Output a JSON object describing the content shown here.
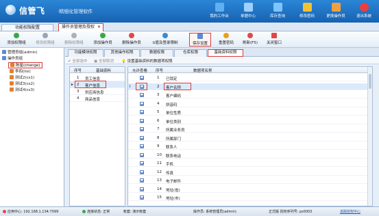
{
  "app": {
    "logo_text": "信管飞",
    "logo_slogan": "·精细化管理软件"
  },
  "header_buttons": [
    {
      "label": "我的工作台",
      "icon": "monitor-icon",
      "color": "#5fb0f0"
    },
    {
      "label": "单据中心",
      "icon": "document-icon",
      "color": "#9fd0ff"
    },
    {
      "label": "库存查询",
      "icon": "box-icon",
      "color": "#7fc4ff"
    },
    {
      "label": "修改密码",
      "icon": "lock-icon",
      "color": "#f2c230"
    },
    {
      "label": "更换操作员",
      "icon": "user-icon",
      "color": "#f0a040"
    },
    {
      "label": "退出系统",
      "icon": "exit-icon",
      "color": "#e84040"
    }
  ],
  "tabs": {
    "left": "功能权限配置",
    "right": "操作员管理及授权",
    "close": "✕"
  },
  "toolbar": [
    {
      "label": "添加权限组",
      "icon": "add-group-icon",
      "color": "#3aa64a",
      "enabled": true
    },
    {
      "label": "修改权限组",
      "icon": "edit-group-icon",
      "color": "#9aa6b2",
      "enabled": false
    },
    {
      "label": "删除权限组",
      "icon": "delete-group-icon",
      "color": "#b0b0b0",
      "enabled": false
    },
    {
      "label": "添加操作员",
      "icon": "add-user-icon",
      "color": "#3aa64a",
      "enabled": true
    },
    {
      "label": "删除操作员",
      "icon": "delete-user-icon",
      "color": "#e04848",
      "enabled": true
    },
    {
      "label": "U盾及登录限制",
      "icon": "usb-key-icon",
      "color": "#3a8ad6",
      "enabled": true
    },
    {
      "label": "保存设置",
      "icon": "save-icon",
      "color": "#5b8ad6",
      "enabled": true
    },
    {
      "label": "重置密码",
      "icon": "key-icon",
      "color": "#e8a020",
      "enabled": true
    },
    {
      "label": "刷新(F5)",
      "icon": "refresh-icon",
      "color": "#e04848",
      "enabled": true
    },
    {
      "label": "关闭窗口",
      "icon": "close-window-icon",
      "color": "#e04848",
      "enabled": true
    }
  ],
  "tree": [
    {
      "label": "管理员组(admin)",
      "level": 0,
      "icon": "folder-icon",
      "color": "#5b8ad6"
    },
    {
      "label": "操作员组",
      "level": 0,
      "icon": "folder-icon",
      "color": "#5b8ad6"
    },
    {
      "label": "陈星(chenge)",
      "level": 1,
      "icon": "user-icon",
      "color": "#e08030",
      "selected": true
    },
    {
      "label": "李四(lisi)",
      "level": 1,
      "icon": "user-icon",
      "color": "#e08030"
    },
    {
      "label": "测试2(cs1)",
      "level": 1,
      "icon": "user-icon",
      "color": "#e08030"
    },
    {
      "label": "测试3(cs2)",
      "level": 1,
      "icon": "user-icon",
      "color": "#e08030"
    },
    {
      "label": "测试4(cs3)",
      "level": 1,
      "icon": "user-icon",
      "color": "#e08030"
    }
  ],
  "func_tabs": [
    {
      "label": "功能模块权限"
    },
    {
      "label": "其他操作权限"
    },
    {
      "label": "数据权限"
    },
    {
      "label": "仓库权限"
    },
    {
      "label": "基础资料权限",
      "active": true
    }
  ],
  "subbar": {
    "select_all": "全部选中",
    "deselect_all": "全部取消",
    "hint": "设置基础资料的数据项权限"
  },
  "left_grid": {
    "headers": [
      "序号",
      "基础资料"
    ],
    "rows": [
      {
        "no": "1",
        "name": "员工信息"
      },
      {
        "no": "2",
        "name": "客户信息",
        "selected": true
      },
      {
        "no": "3",
        "name": "供应商信息"
      },
      {
        "no": "4",
        "name": "商品信息"
      }
    ]
  },
  "right_grid": {
    "headers": [
      "允许查看",
      "序号",
      "数据项名称"
    ],
    "row_marker": "I",
    "rows": [
      {
        "checked": true,
        "no": "1",
        "name": "已锁定"
      },
      {
        "checked": true,
        "no": "2",
        "name": "客户名称",
        "selected": true
      },
      {
        "checked": true,
        "no": "3",
        "name": "客户编码"
      },
      {
        "checked": true,
        "no": "4",
        "name": "拼音码"
      },
      {
        "checked": true,
        "no": "5",
        "name": "单位性质"
      },
      {
        "checked": true,
        "no": "6",
        "name": "单位类别"
      },
      {
        "checked": true,
        "no": "7",
        "name": "所属业务员"
      },
      {
        "checked": true,
        "no": "8",
        "name": "所属部门"
      },
      {
        "checked": true,
        "no": "9",
        "name": "联系人"
      },
      {
        "checked": true,
        "no": "10",
        "name": "联系电话"
      },
      {
        "checked": true,
        "no": "11",
        "name": "手机"
      },
      {
        "checked": true,
        "no": "12",
        "name": "传真"
      },
      {
        "checked": true,
        "no": "13",
        "name": "电子邮件"
      },
      {
        "checked": true,
        "no": "14",
        "name": "地址(省)"
      },
      {
        "checked": true,
        "no": "15",
        "name": "地址(市)"
      }
    ]
  },
  "status": {
    "app_center": "应用中心: 192.168.1.134:7099",
    "connection": "连接状态: 正常",
    "account": "帐套: 演示帐套",
    "operator": "操作员: 系统管理员(admin)",
    "version": "正式版 授权序列号: ps0003",
    "link": "追踪授权中心"
  },
  "colors": {
    "header_top": "#2b86d6",
    "header_bottom": "#1762b2",
    "highlight_red": "#d63b3b",
    "selected_row": "#dbe9fb"
  }
}
